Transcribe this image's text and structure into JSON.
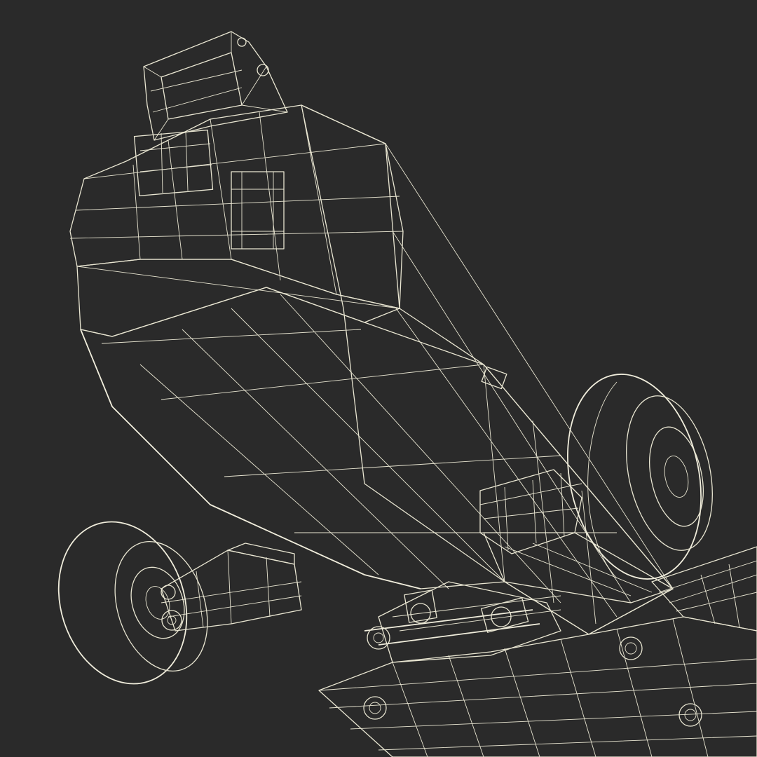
{
  "scene": {
    "caption": "",
    "colors": {
      "background": "#2a2a2a",
      "body_fill": "#7c7b70",
      "body_shade": "#6c6b61",
      "underside_fill": "#6f6e64",
      "tire_fill": "#4a4a43",
      "rim_fill": "#55544c",
      "wire": "#e9e6d2"
    },
    "objects": [
      "main-body",
      "top-bracket",
      "right-wheel",
      "left-wheel",
      "left-axle-arm",
      "right-axle-arm",
      "base-frame",
      "center-linkage"
    ]
  }
}
